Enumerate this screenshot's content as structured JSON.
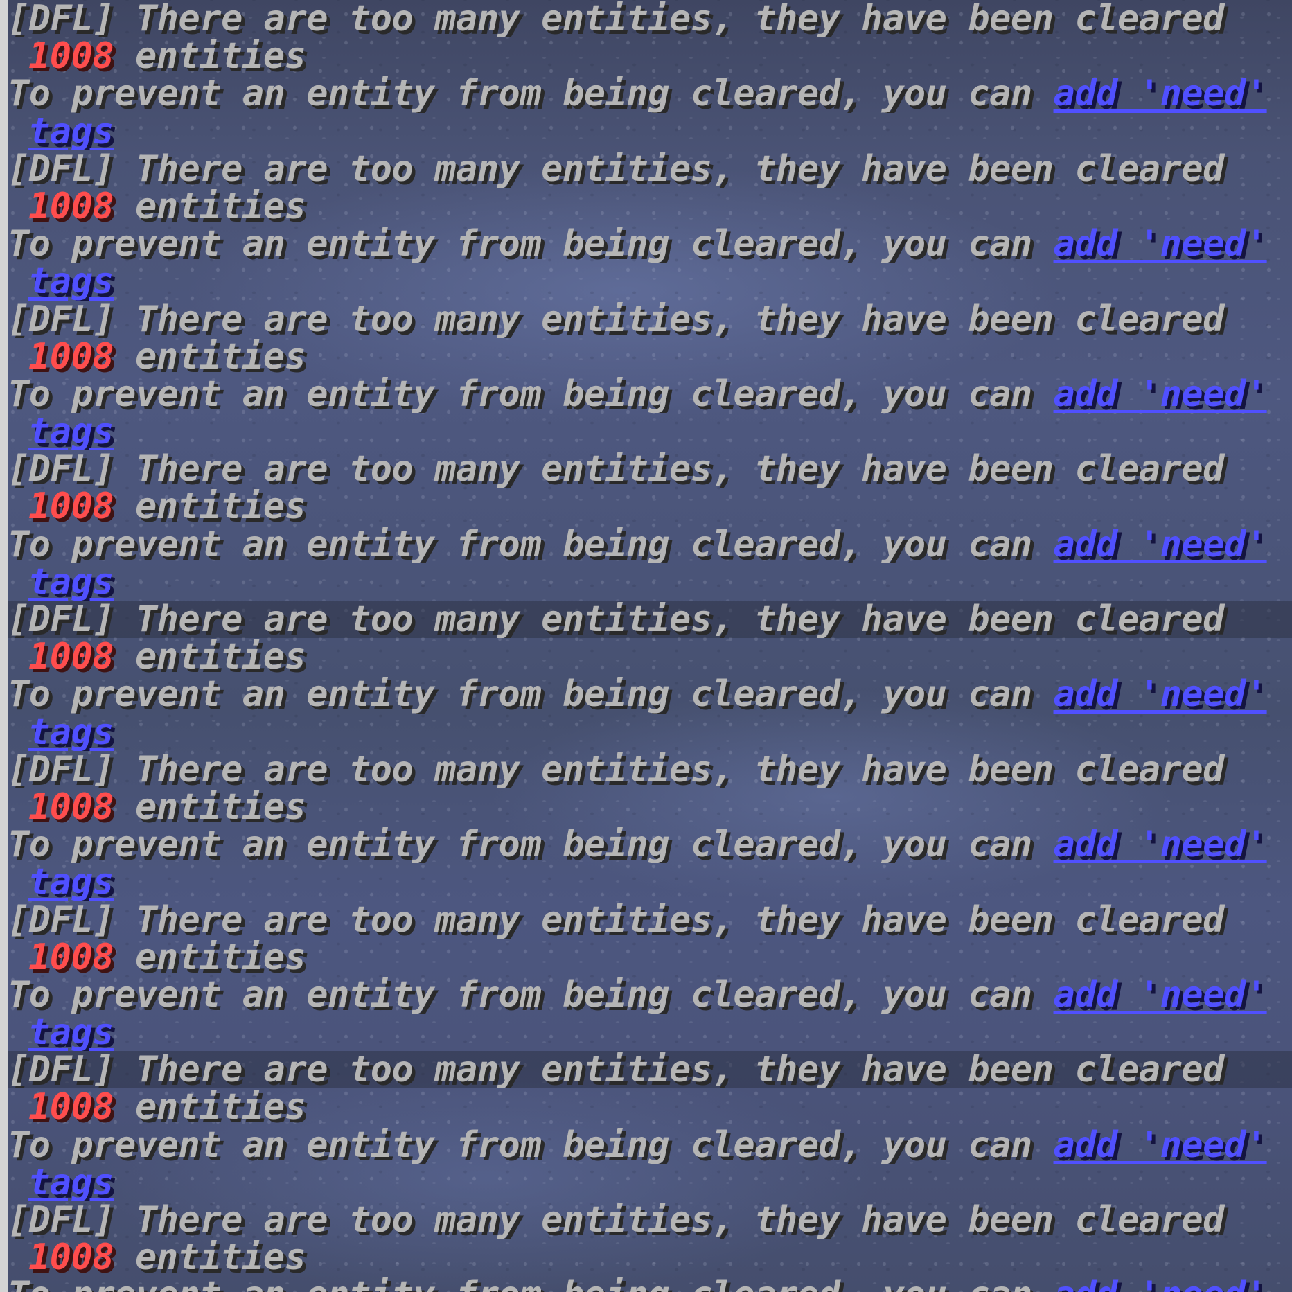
{
  "chat": {
    "messages": [
      {
        "header": "[DFL] There are too many entities, they have been cleared",
        "count": "1008",
        "count_suffix": " entities",
        "prevent_text": "To prevent an entity from being cleared, you can ",
        "link_label": "add 'need'",
        "link_wrap": "tags"
      },
      {
        "header": "[DFL] There are too many entities, they have been cleared",
        "count": "1008",
        "count_suffix": " entities",
        "prevent_text": "To prevent an entity from being cleared, you can ",
        "link_label": "add 'need'",
        "link_wrap": "tags"
      },
      {
        "header": "[DFL] There are too many entities, they have been cleared",
        "count": "1008",
        "count_suffix": " entities",
        "prevent_text": "To prevent an entity from being cleared, you can ",
        "link_label": "add 'need'",
        "link_wrap": "tags"
      },
      {
        "header": "[DFL] There are too many entities, they have been cleared",
        "count": "1008",
        "count_suffix": " entities",
        "prevent_text": "To prevent an entity from being cleared, you can ",
        "link_label": "add 'need'",
        "link_wrap": "tags"
      },
      {
        "header": "[DFL] There are too many entities, they have been cleared",
        "count": "1008",
        "count_suffix": " entities",
        "prevent_text": "To prevent an entity from being cleared, you can ",
        "link_label": "add 'need'",
        "link_wrap": "tags"
      },
      {
        "header": "[DFL] There are too many entities, they have been cleared",
        "count": "1008",
        "count_suffix": " entities",
        "prevent_text": "To prevent an entity from being cleared, you can ",
        "link_label": "add 'need'",
        "link_wrap": "tags"
      },
      {
        "header": "[DFL] There are too many entities, they have been cleared",
        "count": "1008",
        "count_suffix": " entities",
        "prevent_text": "To prevent an entity from being cleared, you can ",
        "link_label": "add 'need'",
        "link_wrap": "tags"
      },
      {
        "header": "[DFL] There are too many entities, they have been cleared",
        "count": "1008",
        "count_suffix": " entities",
        "prevent_text": "To prevent an entity from being cleared, you can ",
        "link_label": "add 'need'",
        "link_wrap": "tags"
      },
      {
        "header": "[DFL] There are too many entities, they have been cleared",
        "count": "1008",
        "count_suffix": " entities",
        "prevent_text": "To prevent an entity from being cleared, you can ",
        "link_label": "add 'need'",
        "link_wrap": ""
      }
    ]
  },
  "colors": {
    "text": "#b5b5b5",
    "count": "#ff4d4d",
    "link": "#5050ff"
  }
}
